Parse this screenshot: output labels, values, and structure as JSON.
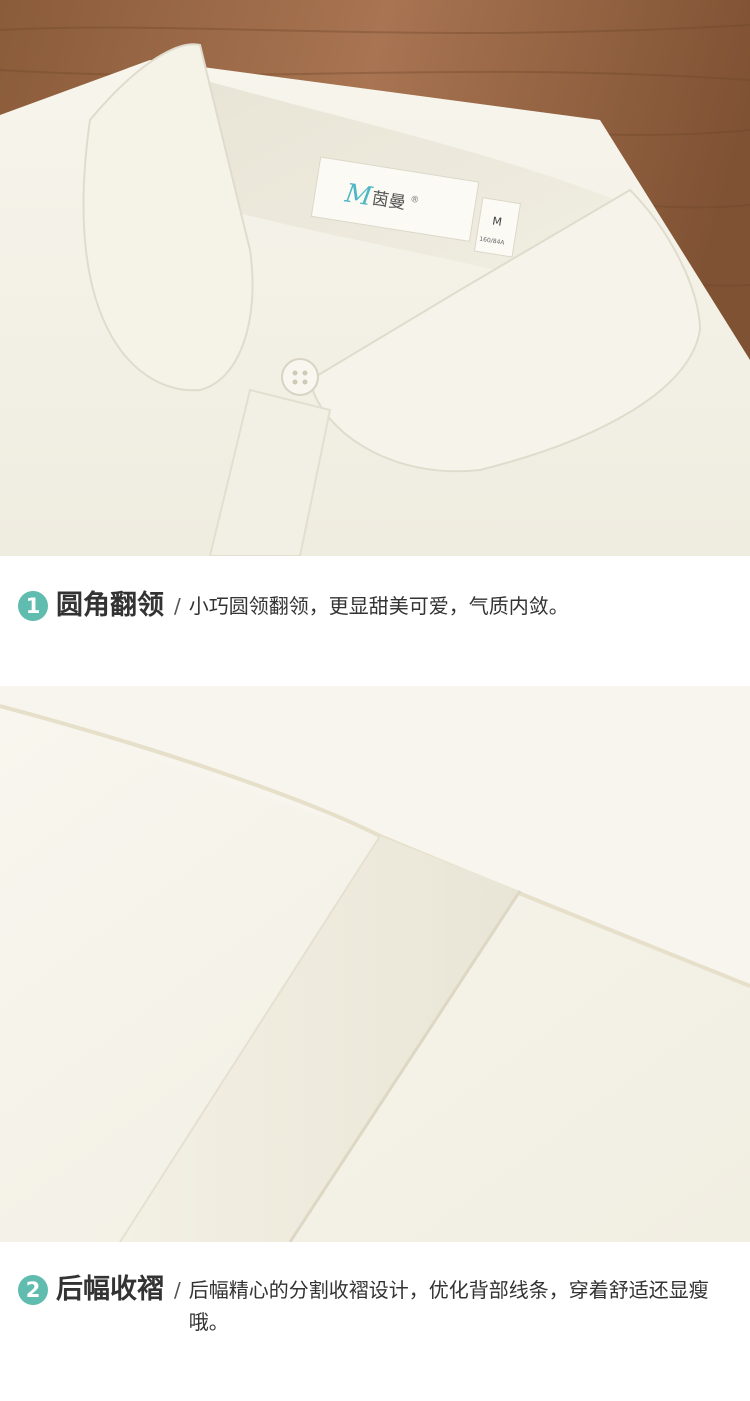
{
  "label": {
    "logo_letter": "M",
    "brand": "茵曼",
    "registered": "®",
    "size": "M",
    "size_detail": "160/84A"
  },
  "features": [
    {
      "number": "1",
      "title": "圆角翻领",
      "separator": "/",
      "description": "小巧圆领翻领，更显甜美可爱，气质内敛。"
    },
    {
      "number": "2",
      "title": "后幅收褶",
      "separator": "/",
      "description": "后幅精心的分割收褶设计，优化背部线条，穿着舒适还显瘦哦。"
    }
  ],
  "colors": {
    "accent": "#5fbcae",
    "fabric": "#f4f1e6",
    "wood": "#9a6a45"
  }
}
